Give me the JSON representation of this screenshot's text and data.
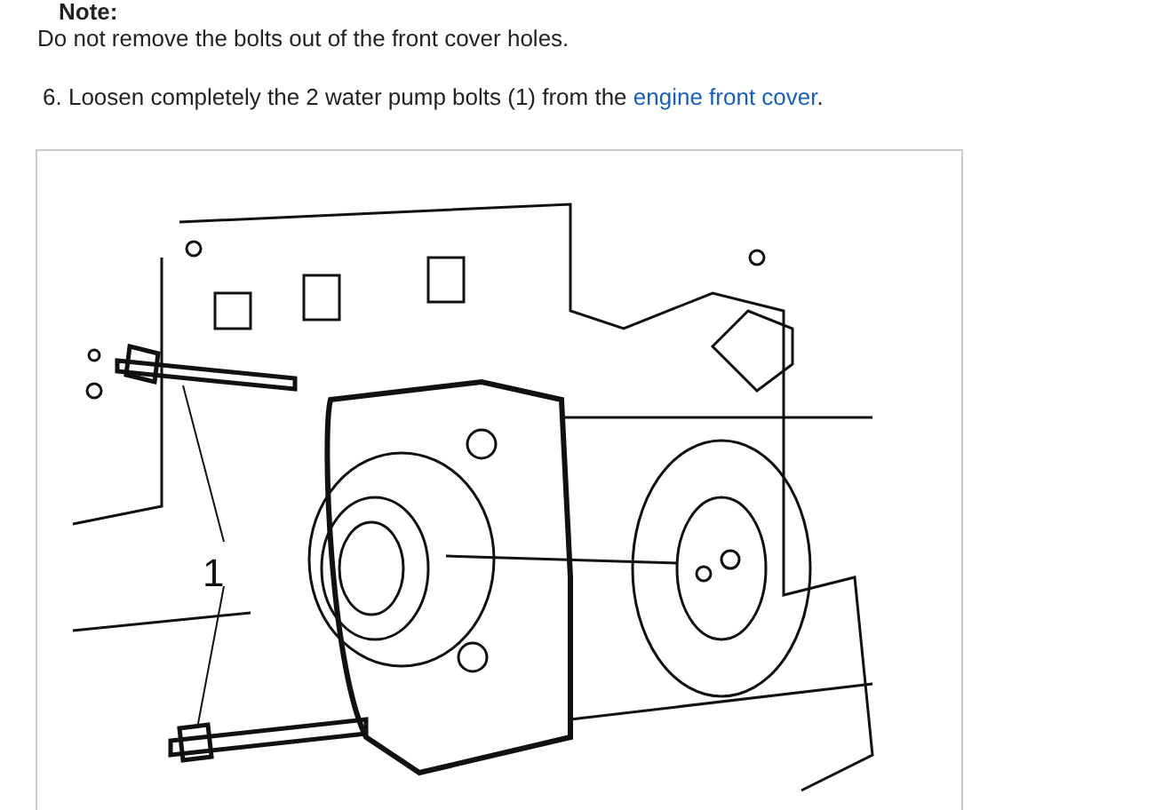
{
  "note": {
    "label": "Note:",
    "text": "Do not remove the bolts out of the front cover holes."
  },
  "step": {
    "number": "6.",
    "text_before": "Loosen completely the 2 water pump bolts (1) from the ",
    "link": "engine front cover",
    "text_after": "."
  },
  "figure": {
    "callout": "1"
  }
}
